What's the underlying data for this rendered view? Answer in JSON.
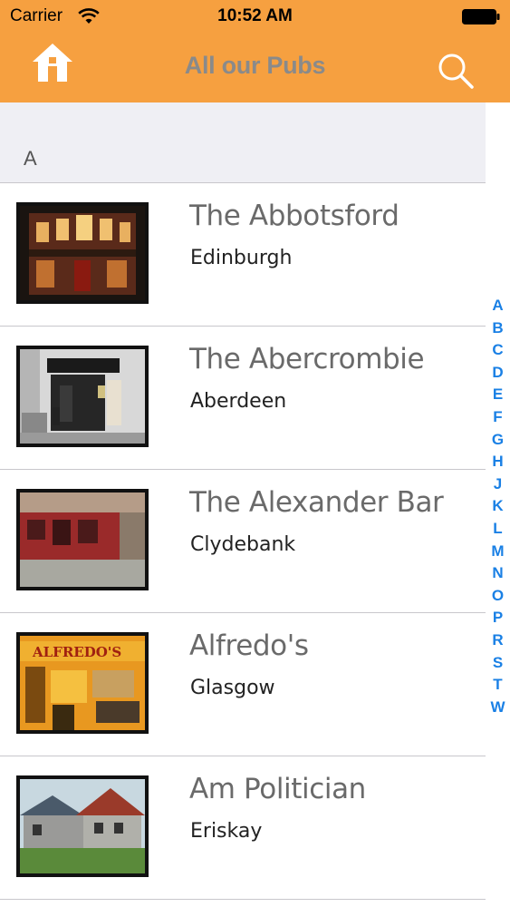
{
  "status_bar": {
    "carrier": "Carrier",
    "time": "10:52 AM"
  },
  "navbar": {
    "title": "All our Pubs",
    "home_icon": "home-icon",
    "search_icon": "search-icon",
    "color": "#f6a040"
  },
  "section": {
    "letter": "A"
  },
  "pubs": [
    {
      "name": "The Abbotsford",
      "city": "Edinburgh"
    },
    {
      "name": "The Abercrombie",
      "city": "Aberdeen"
    },
    {
      "name": "The Alexander Bar",
      "city": "Clydebank"
    },
    {
      "name": "Alfredo's",
      "city": "Glasgow"
    },
    {
      "name": "Am Politician",
      "city": "Eriskay"
    }
  ],
  "thumb_signs": {
    "alfredos": "ALFREDO'S"
  },
  "index_letters": [
    "A",
    "B",
    "C",
    "D",
    "E",
    "F",
    "G",
    "H",
    "J",
    "K",
    "L",
    "M",
    "N",
    "O",
    "P",
    "R",
    "S",
    "T",
    "W"
  ],
  "accent_color": "#1a80e5"
}
